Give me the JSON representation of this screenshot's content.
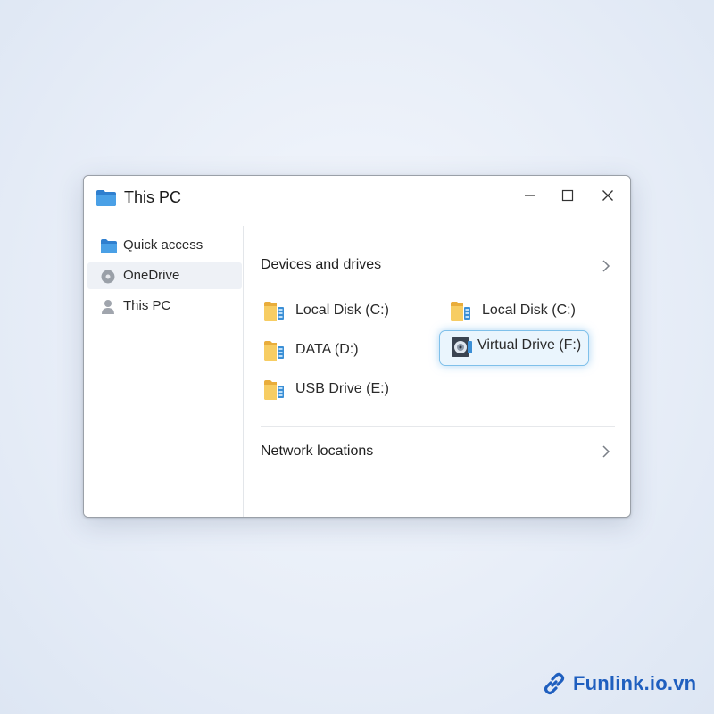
{
  "window": {
    "title": "This PC",
    "title_icon": "folder-icon",
    "controls": [
      "minimize-icon",
      "maximize-icon",
      "close-icon"
    ]
  },
  "sidebar": {
    "items": [
      {
        "label": "Quick access",
        "icon": "folder-icon",
        "selected": false
      },
      {
        "label": "OneDrive",
        "icon": "cloud-disc-icon",
        "selected": true
      },
      {
        "label": "This PC",
        "icon": "person-icon",
        "selected": false
      }
    ]
  },
  "content": {
    "devices_section": {
      "title": "Devices and drives"
    },
    "drives": [
      {
        "label": "Local Disk (C:)",
        "icon": "drive-folder-icon"
      },
      {
        "label": "DATA (D:)",
        "icon": "drive-folder-icon"
      },
      {
        "label": "USB Drive (E:)",
        "icon": "drive-folder-icon"
      },
      {
        "label": "Local Disk (C:)",
        "icon": "drive-folder-icon"
      },
      {
        "label": "Virtual Drive (F:)",
        "icon": "disc-drive-icon",
        "highlighted": true
      }
    ],
    "network_section": {
      "title": "Network locations"
    }
  },
  "watermark": {
    "text": "Funlink.io.vn",
    "icon": "link-icon"
  },
  "colors": {
    "accent": "#1f5fbf",
    "folder_yellow": "#f5c451",
    "folder_blue": "#3b8fd6",
    "highlight_border": "#7fc0ea",
    "highlight_bg": "#eaf5fd",
    "selected_bg": "#eef1f6"
  }
}
